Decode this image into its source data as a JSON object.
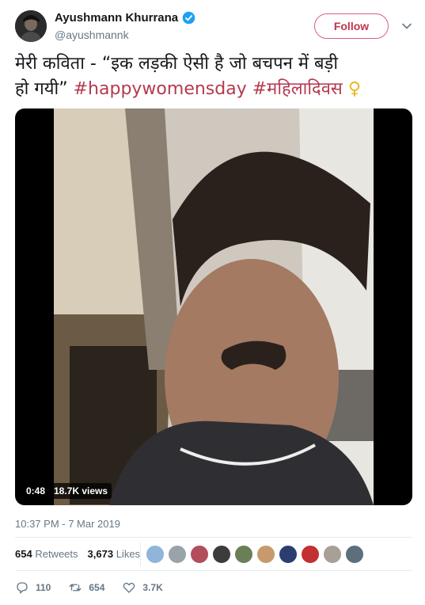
{
  "user": {
    "name": "Ayushmann Khurrana",
    "handle": "@ayushmannk",
    "follow_label": "Follow"
  },
  "tweet": {
    "text_line1": "मेरी कविता - “इक लड़की ऐसी है जो बचपन में बड़ी",
    "text_line2": "हो गयी”",
    "hashtag1": "#happywomensday",
    "hashtag2": "#महिलादिवस",
    "emoji": "♀"
  },
  "video": {
    "duration": "0:48",
    "views": "18.7K views"
  },
  "timestamp": "10:37 PM - 7 Mar 2019",
  "stats": {
    "retweets_count": "654",
    "retweets_label": "Retweets",
    "likes_count": "3,673",
    "likes_label": "Likes"
  },
  "actions": {
    "replies": "110",
    "retweets": "654",
    "likes": "3.7K"
  },
  "colors": {
    "accent": "#c2334f",
    "hashtag": "#b5394f",
    "verified": "#1da1f2",
    "muted": "#657786"
  }
}
